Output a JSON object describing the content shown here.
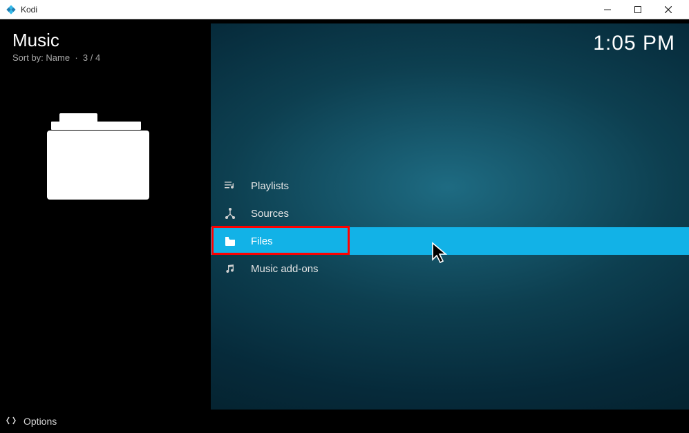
{
  "window": {
    "title": "Kodi"
  },
  "header": {
    "title": "Music",
    "sort_label": "Sort by: Name",
    "position": "3 / 4"
  },
  "clock": "1:05 PM",
  "menu": {
    "items": [
      {
        "label": "Playlists",
        "icon": "playlist-icon",
        "selected": false
      },
      {
        "label": "Sources",
        "icon": "sources-icon",
        "selected": false
      },
      {
        "label": "Files",
        "icon": "folder-icon",
        "selected": true
      },
      {
        "label": "Music add-ons",
        "icon": "music-icon",
        "selected": false
      }
    ]
  },
  "bottom": {
    "options": "Options"
  },
  "annotation": {
    "highlight_index": 2
  }
}
